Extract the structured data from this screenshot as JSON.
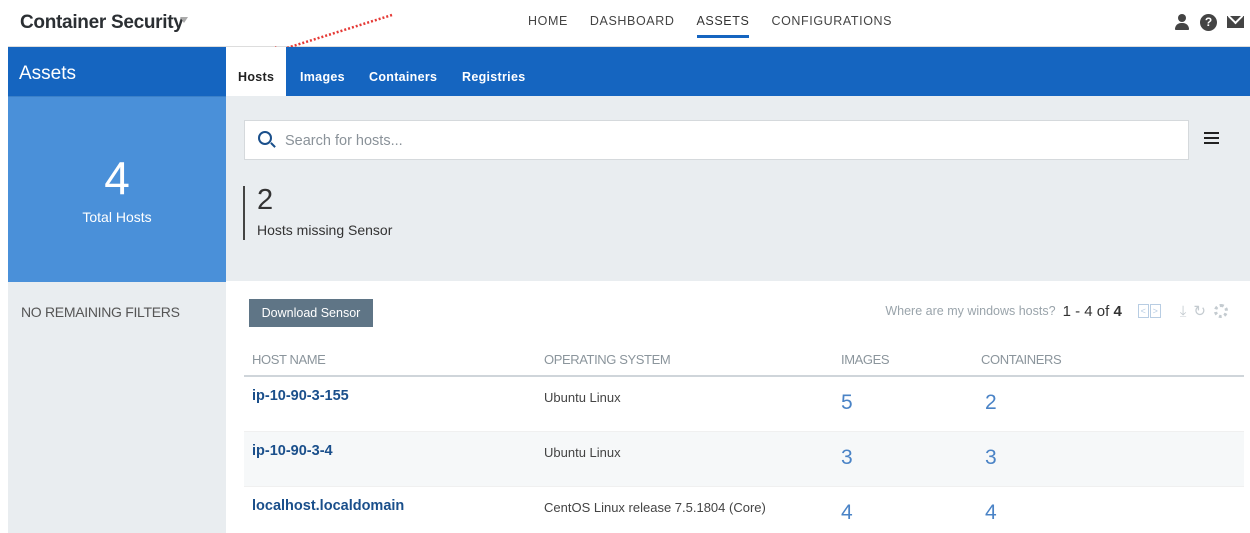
{
  "app": {
    "title": "Container Security"
  },
  "nav": {
    "items": [
      "HOME",
      "DASHBOARD",
      "ASSETS",
      "CONFIGURATIONS"
    ],
    "active": "ASSETS"
  },
  "sidebar": {
    "header": "Assets",
    "stat_value": "4",
    "stat_label": "Total Hosts",
    "filters_label": "NO REMAINING FILTERS"
  },
  "tabs": [
    "Hosts",
    "Images",
    "Containers",
    "Registries"
  ],
  "search": {
    "placeholder": "Search for hosts..."
  },
  "metric": {
    "value": "2",
    "label": "Hosts missing Sensor"
  },
  "toolbar": {
    "download_label": "Download Sensor",
    "windows_link": "Where are my windows hosts?",
    "range_prefix": "1 - 4 of",
    "range_total": "4"
  },
  "table": {
    "columns": [
      "HOST NAME",
      "OPERATING SYSTEM",
      "IMAGES",
      "CONTAINERS"
    ],
    "rows": [
      {
        "host": "ip-10-90-3-155",
        "os": "Ubuntu Linux",
        "images": "5",
        "containers": "2"
      },
      {
        "host": "ip-10-90-3-4",
        "os": "Ubuntu Linux",
        "images": "3",
        "containers": "3"
      },
      {
        "host": "localhost.localdomain",
        "os": "CentOS Linux release 7.5.1804 (Core)",
        "images": "4",
        "containers": "4"
      }
    ]
  },
  "colors": {
    "primary": "#1565c0",
    "stat_card": "#4a90d9",
    "panel": "#e9edf0",
    "annotation": "#e53935"
  }
}
